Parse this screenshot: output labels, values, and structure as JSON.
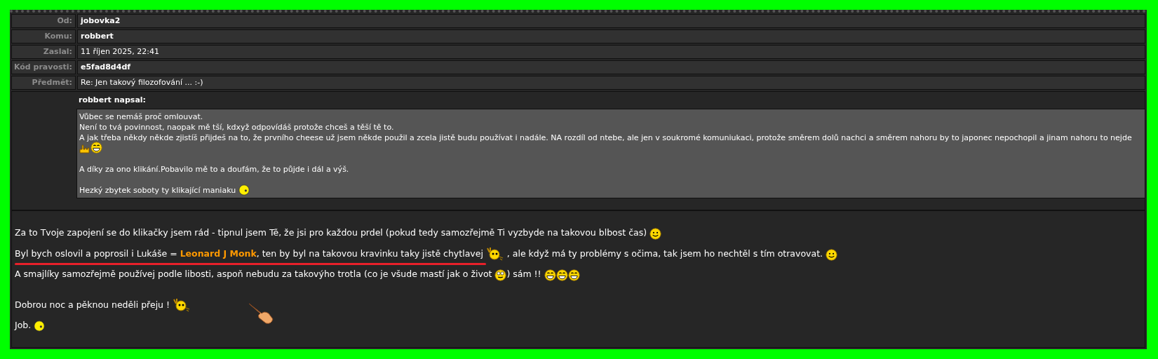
{
  "header_rows": [
    {
      "label": "Od:",
      "value": "jobovka2",
      "bold": true
    },
    {
      "label": "Komu:",
      "value": "robbert",
      "bold": true
    },
    {
      "label": "Zaslal:",
      "value": "11 říjen 2025, 22:41",
      "bold": false
    },
    {
      "label": "Kód pravosti:",
      "value": "e5fad8d4df",
      "bold": true
    },
    {
      "label": "Předmět:",
      "value": "Re: Jen takový filozofování ... :-)",
      "bold": false
    }
  ],
  "quote": {
    "author": "robbert napsal:",
    "lines": [
      {
        "gap_before": false,
        "parts": [
          {
            "kind": "text",
            "text": "Vůbec se nemáš proč omlouvat."
          }
        ]
      },
      {
        "gap_before": false,
        "parts": [
          {
            "kind": "text",
            "text": "Není to tvá povinnost, naopak mě tší, kdxyž odpovídáš protože chceš a těší tě to."
          }
        ]
      },
      {
        "gap_before": false,
        "parts": [
          {
            "kind": "text",
            "text": "A jak třeba někdy někde zjistíš přijdeš na to, že prvního cheese už jsem někde použil a zcela jistě budu používat i nadále. NA rozdíl od ntebe, ale jen v soukromé komuniukaci, protože směrem dolů nachci a směrem nahoru by to japonec nepochopil a jinam nahoru to nejde"
          }
        ]
      },
      {
        "gap_before": false,
        "parts": [
          {
            "kind": "icon"
          },
          {
            "kind": "icon"
          }
        ]
      },
      {
        "gap_before": true,
        "parts": [
          {
            "kind": "text",
            "text": "A díky za ono klikání.Pobavilo mě to a doufám, že to půjde i dál a výš."
          }
        ]
      },
      {
        "gap_before": true,
        "parts": [
          {
            "kind": "text",
            "text": "Hezký zbytek soboty ty klikající maniaku "
          },
          {
            "kind": "icon"
          }
        ]
      }
    ]
  },
  "body": [
    {
      "underlined": false,
      "parts": [
        {
          "kind": "text",
          "text": "Za to Tvoje zapojení se do klikačky jsem rád - tipnul jsem Tě, že jsi pro každou prdel (pokud tedy samozřejmě Ti vyzbyde na takovou blbost čas) "
        },
        {
          "kind": "icon"
        }
      ]
    },
    {
      "underlined": true,
      "parts": [
        {
          "kind": "text",
          "text": "Byl bych oslovil a poprosil i Lukáše = "
        },
        {
          "kind": "link",
          "text": "Leonard J Monk"
        },
        {
          "kind": "text",
          "text": ", ten by byl na takovou kravinku taky jistě chytlavej "
        },
        {
          "kind": "icon"
        },
        {
          "kind": "text",
          "text": " , ale když má ty problémy s očima, tak jsem ho nechtěl s tím otravovat. "
        },
        {
          "kind": "icon"
        }
      ]
    },
    {
      "underlined": false,
      "parts": [
        {
          "kind": "text",
          "text": "A smajlíky samozřejmě používej podle libosti, aspoň nebudu za takovýho trotla (co je všude mastí jak o život "
        },
        {
          "kind": "icon"
        },
        {
          "kind": "text",
          "text": ") sám !! "
        },
        {
          "kind": "icon"
        },
        {
          "kind": "icon"
        },
        {
          "kind": "icon"
        }
      ]
    },
    {
      "underlined": false,
      "parts": [
        {
          "kind": "text",
          "text": "Dobrou noc a pěknou neděli přeju ! "
        },
        {
          "kind": "icon"
        }
      ]
    },
    {
      "underlined": false,
      "parts": [
        {
          "kind": "text",
          "text": "Job. "
        },
        {
          "kind": "icon"
        }
      ]
    }
  ]
}
